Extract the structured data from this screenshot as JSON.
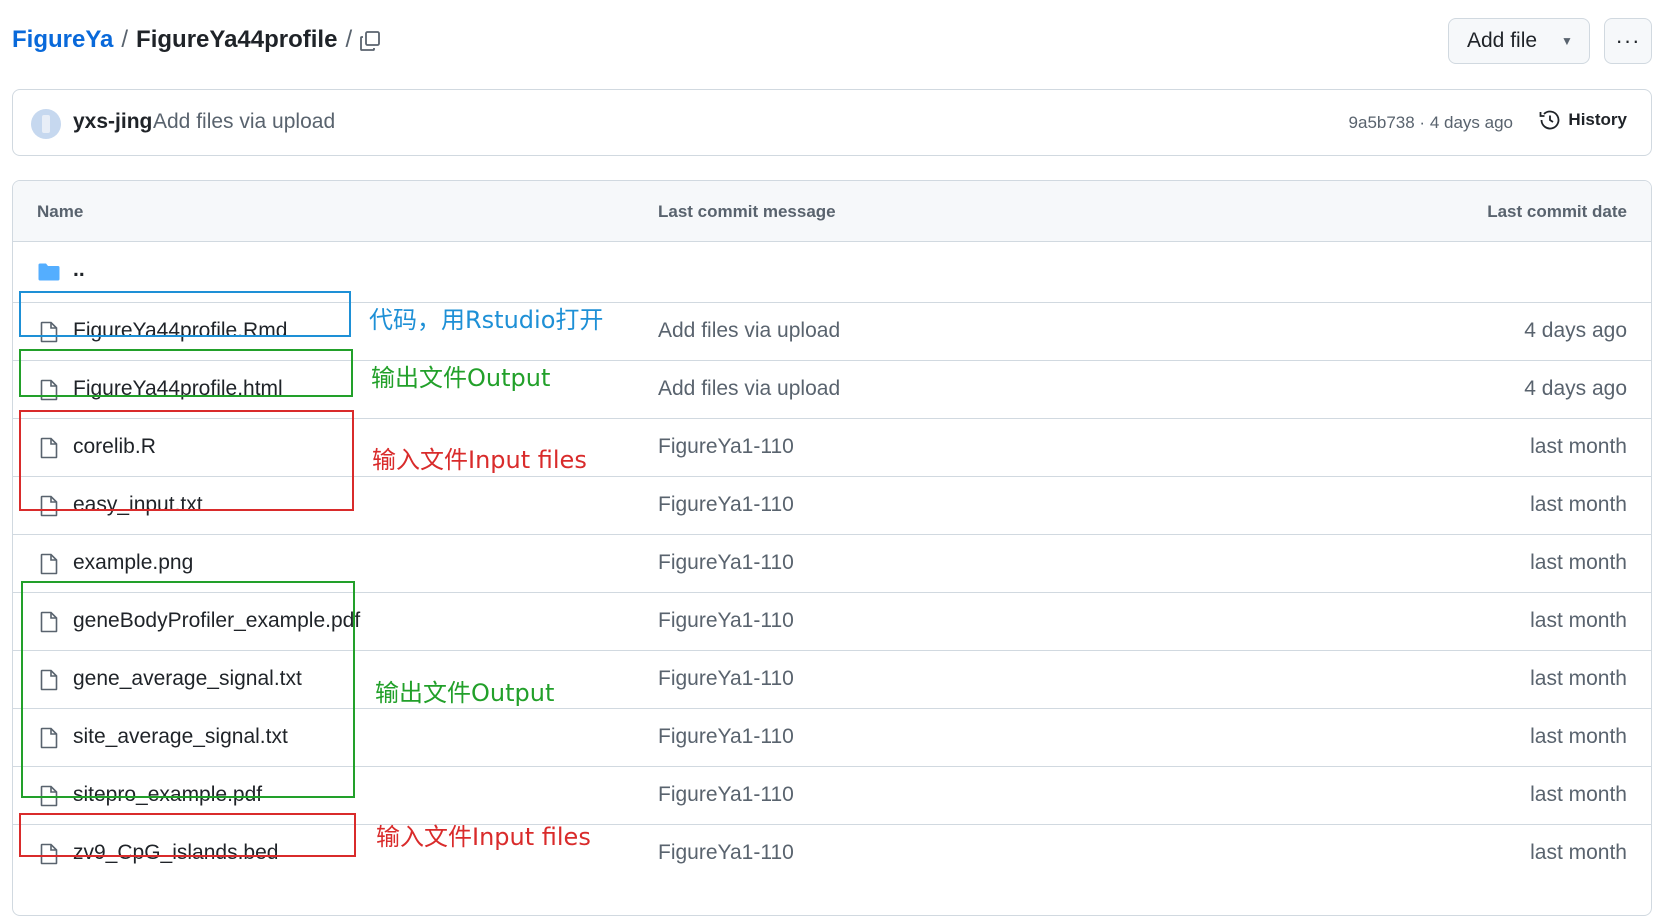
{
  "header": {
    "owner": "FigureYa",
    "separator": "/",
    "repo": "FigureYa44profile",
    "trailing_separator": "/",
    "add_file_label": "Add file",
    "more_label": "···"
  },
  "commit": {
    "author": "yxs-jing",
    "message": "Add files via upload",
    "meta": "9a5b738 · 4 days ago",
    "history_label": "History"
  },
  "table": {
    "col_name": "Name",
    "col_message": "Last commit message",
    "col_date": "Last commit date",
    "parent_label": "..",
    "files": [
      {
        "name": "FigureYa44profile.Rmd",
        "message": "Add files via upload",
        "date": "4 days ago"
      },
      {
        "name": "FigureYa44profile.html",
        "message": "Add files via upload",
        "date": "4 days ago"
      },
      {
        "name": "corelib.R",
        "message": "FigureYa1-110",
        "date": "last month"
      },
      {
        "name": "easy_input.txt",
        "message": "FigureYa1-110",
        "date": "last month"
      },
      {
        "name": "example.png",
        "message": "FigureYa1-110",
        "date": "last month"
      },
      {
        "name": "geneBodyProfiler_example.pdf",
        "message": "FigureYa1-110",
        "date": "last month"
      },
      {
        "name": "gene_average_signal.txt",
        "message": "FigureYa1-110",
        "date": "last month"
      },
      {
        "name": "site_average_signal.txt",
        "message": "FigureYa1-110",
        "date": "last month"
      },
      {
        "name": "sitepro_example.pdf",
        "message": "FigureYa1-110",
        "date": "last month"
      },
      {
        "name": "zv9_CpG_islands.bed",
        "message": "FigureYa1-110",
        "date": "last month"
      }
    ]
  },
  "annotations": {
    "code": "代码，用Rstudio打开",
    "output_1": "输出文件Output",
    "input_1": "输入文件Input files",
    "output_2": "输出文件Output",
    "input_2": "输入文件Input files"
  },
  "colors": {
    "link": "#0969da",
    "annotation_blue": "#1e90d6",
    "annotation_green": "#22a02a",
    "annotation_red": "#d92b2b",
    "folder": "#54aeff"
  }
}
